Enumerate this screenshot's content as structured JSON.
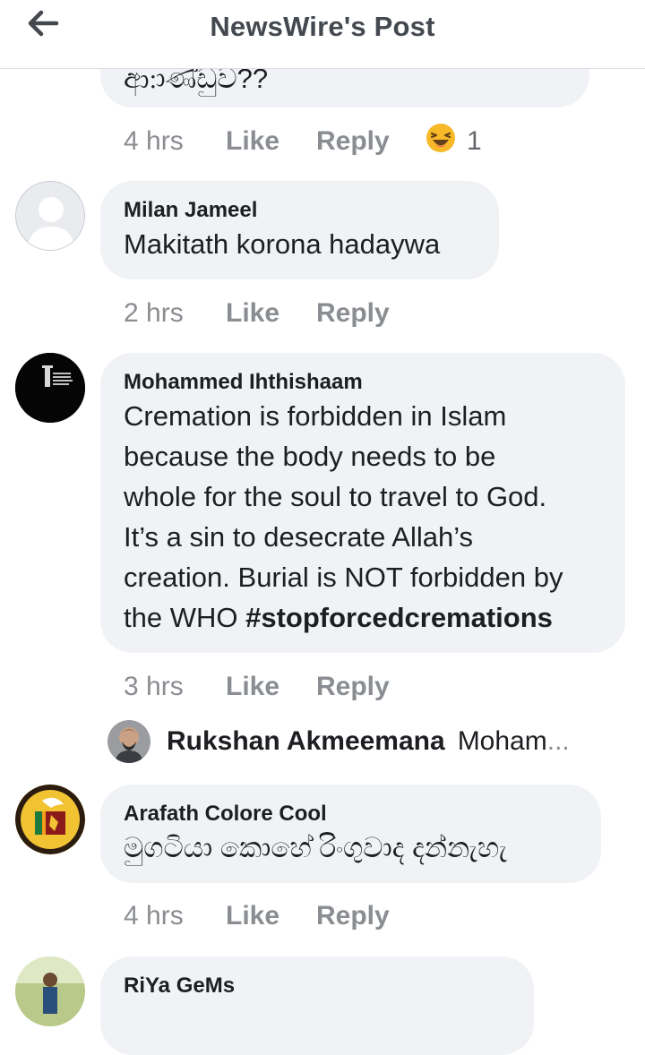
{
  "header": {
    "title": "NewsWire's Post",
    "back_icon": "arrow-left-icon"
  },
  "comments": [
    {
      "text": "ආ:ාණ්ඩුව??",
      "time": "4 hrs",
      "like": "Like",
      "reply": "Reply",
      "reaction_icon": "haha-emoji-icon",
      "reaction_count": "1"
    },
    {
      "author": "Milan Jameel",
      "text": "Makitath korona hadaywa",
      "time": "2 hrs",
      "like": "Like",
      "reply": "Reply"
    },
    {
      "author": "Mohammed Ihthishaam",
      "text_lines": [
        "Cremation is forbidden in Islam",
        "because the body needs to be",
        "whole for the soul to travel to God.",
        "It’s a sin to desecrate Allah’s",
        "creation. Burial is NOT forbidden by",
        "the WHO "
      ],
      "hashtag": "#stopforcedcremations",
      "time": "3 hrs",
      "like": "Like",
      "reply": "Reply",
      "reply_preview": {
        "author": "Rukshan Akmeemana",
        "snippet": "Moham",
        "ellipsis": "..."
      }
    },
    {
      "author": "Arafath Colore Cool",
      "text": "මුගටියා කොහේ රිංගුවාද දන්නැහැ",
      "time": "4 hrs",
      "like": "Like",
      "reply": "Reply"
    },
    {
      "author": "RiYa GeMs"
    }
  ],
  "colors": {
    "bubble": "#f0f2f5",
    "meta_text": "#8a8d91",
    "header_text": "#444950",
    "body_text": "#1c1e21"
  }
}
